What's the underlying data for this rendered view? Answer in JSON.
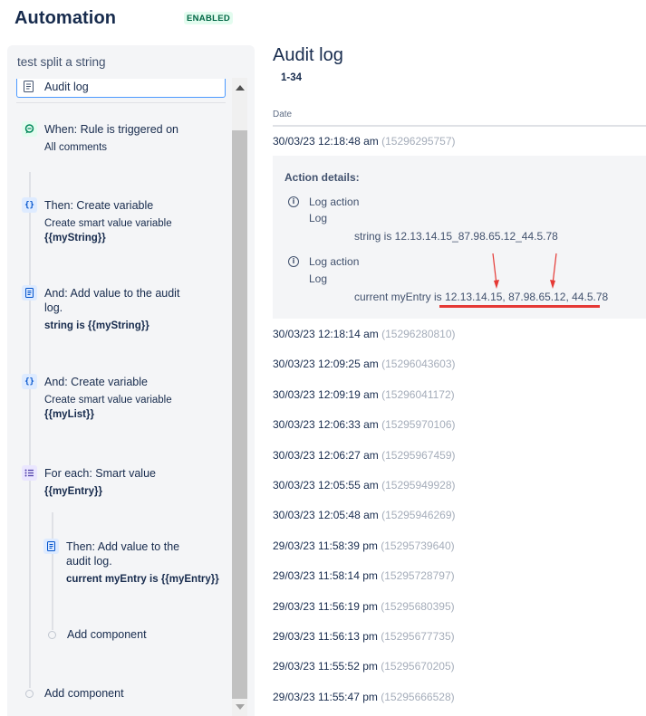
{
  "header": {
    "title": "Automation",
    "status": "ENABLED"
  },
  "rule": {
    "name": "test split a string",
    "selected_item": "Audit log",
    "components": [
      {
        "title": "When: Rule is triggered on",
        "sub": "All comments",
        "bold": "",
        "icon": "chat-icon"
      },
      {
        "title": "Then: Create variable",
        "sub": "Create smart value variable",
        "bold": "{{myString}}",
        "icon": "variable-icon"
      },
      {
        "title": "And: Add value to the audit log.",
        "sub": "",
        "bold": "string is {{myString}}",
        "icon": "audit-log-icon"
      },
      {
        "title": "And: Create variable",
        "sub": "Create smart value variable",
        "bold": "{{myList}}",
        "icon": "variable-icon"
      },
      {
        "title": "For each: Smart value",
        "sub": "",
        "bold": "{{myEntry}}",
        "icon": "list-icon"
      },
      {
        "title": "Then: Add value to the audit log.",
        "sub": "",
        "bold": "current myEntry is {{myEntry}}",
        "icon": "audit-log-icon"
      }
    ],
    "add_component_inner": "Add component",
    "add_component_outer": "Add component"
  },
  "audit_log": {
    "title": "Audit log",
    "range": "1-34",
    "column_date": "Date",
    "expanded": {
      "date": "30/03/23 12:18:48 am",
      "id": "(15296295757)",
      "details_title": "Action details:",
      "actions": [
        {
          "label": "Log action",
          "sub": "Log",
          "message": "string is 12.13.14.15_87.98.65.12_44.5.78"
        },
        {
          "label": "Log action",
          "sub": "Log",
          "message": "current myEntry is 12.13.14.15, 87.98.65.12, 44.5.78"
        }
      ]
    },
    "entries": [
      {
        "date": "30/03/23 12:18:14 am",
        "id": "(15296280810)"
      },
      {
        "date": "30/03/23 12:09:25 am",
        "id": "(15296043603)"
      },
      {
        "date": "30/03/23 12:09:19 am",
        "id": "(15296041172)"
      },
      {
        "date": "30/03/23 12:06:33 am",
        "id": "(15295970106)"
      },
      {
        "date": "30/03/23 12:06:27 am",
        "id": "(15295967459)"
      },
      {
        "date": "30/03/23 12:05:55 am",
        "id": "(15295949928)"
      },
      {
        "date": "30/03/23 12:05:48 am",
        "id": "(15295946269)"
      },
      {
        "date": "29/03/23 11:58:39 pm",
        "id": "(15295739640)"
      },
      {
        "date": "29/03/23 11:58:14 pm",
        "id": "(15295728797)"
      },
      {
        "date": "29/03/23 11:56:19 pm",
        "id": "(15295680395)"
      },
      {
        "date": "29/03/23 11:56:13 pm",
        "id": "(15295677735)"
      },
      {
        "date": "29/03/23 11:55:52 pm",
        "id": "(15295670205)"
      },
      {
        "date": "29/03/23 11:55:47 pm",
        "id": "(15295666528)"
      }
    ]
  },
  "colors": {
    "annotation_red": "#e53935",
    "status_green": "#006644"
  }
}
